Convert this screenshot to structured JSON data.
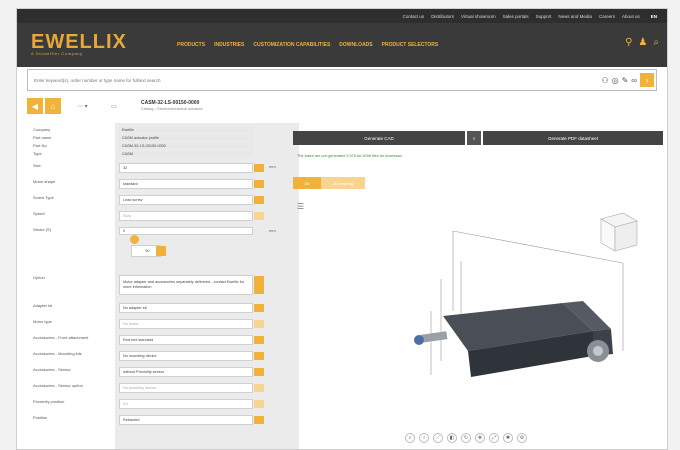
{
  "topbar": {
    "links": [
      "Contact us",
      "Distributors",
      "Virtual showroom",
      "Sales portals",
      "Support",
      "News and Media",
      "Careers",
      "About us"
    ],
    "language": "EN"
  },
  "brand": {
    "name": "EWELLIX",
    "tagline": "A Schaeffler Company"
  },
  "nav": [
    "PRODUCTS",
    "INDUSTRIES",
    "CUSTOMIZATION CAPABILITIES",
    "DOWNLOADS",
    "PRODUCT SELECTORS"
  ],
  "search": {
    "placeholder": "Enter keyword(s), order number or type name for fulltext search"
  },
  "product": {
    "title": "CASM-32-LS-00150-0000",
    "subtitle": "Catalog  >  Electromechanical actuators"
  },
  "rows": [
    {
      "label": "Company",
      "value": "Ewellix",
      "kind": "static"
    },
    {
      "label": "Part name",
      "value": "CASM actuator profile",
      "kind": "static"
    },
    {
      "label": "Part No",
      "value": "CASM-32-LS-00150-0000",
      "kind": "static"
    },
    {
      "label": "Type",
      "value": "CASM",
      "kind": "static"
    },
    {
      "label": "Size",
      "value": "32",
      "kind": "select",
      "unit": "mm"
    },
    {
      "label": "Motor shape",
      "value": "standard",
      "kind": "select"
    },
    {
      "label": "Screw Type",
      "value": "Lead screw",
      "kind": "select"
    },
    {
      "label": "Speed",
      "value": "Slow",
      "kind": "select-disabled"
    },
    {
      "label": "Stroke (S)",
      "value": "0",
      "kind": "input",
      "unit": "mm"
    },
    {
      "label": "",
      "value": "50",
      "kind": "stepper"
    },
    {
      "label": "Option",
      "value": "Motor adapter and accessories separately delivered - contact Ewellix for more information",
      "kind": "select-tall"
    },
    {
      "label": "Adapter kit",
      "value": "No adapter kit",
      "kind": "select"
    },
    {
      "label": "Motor type",
      "value": "No motor",
      "kind": "select-disabled"
    },
    {
      "label": "Accessories - Front attachment",
      "value": "Rod end standard",
      "kind": "select"
    },
    {
      "label": "Accessories - Mounting kits",
      "value": "No mounting device",
      "kind": "select"
    },
    {
      "label": "Accessories - Sensor",
      "value": "without Proximity sensor",
      "kind": "select"
    },
    {
      "label": "Accessories - Sensor option",
      "value": "No proximity sensor",
      "kind": "select-disabled"
    },
    {
      "label": "Proximity position",
      "value": "0.0",
      "kind": "select-disabled"
    },
    {
      "label": "Position",
      "value": "Retracted",
      "kind": "select"
    }
  ],
  "buttons": {
    "cad": "Generate CAD",
    "pdf": "Generate PDF datasheet"
  },
  "note": "The token are pre-generated 3,978 for 3098 files for download.",
  "tabs": [
    "3D",
    "2D drawing"
  ],
  "colors": {
    "accent": "#f0b23a",
    "dark": "#3a3a3a"
  },
  "icons": {
    "pin": "map-pin-icon",
    "user": "user-icon",
    "search": "search-icon"
  }
}
